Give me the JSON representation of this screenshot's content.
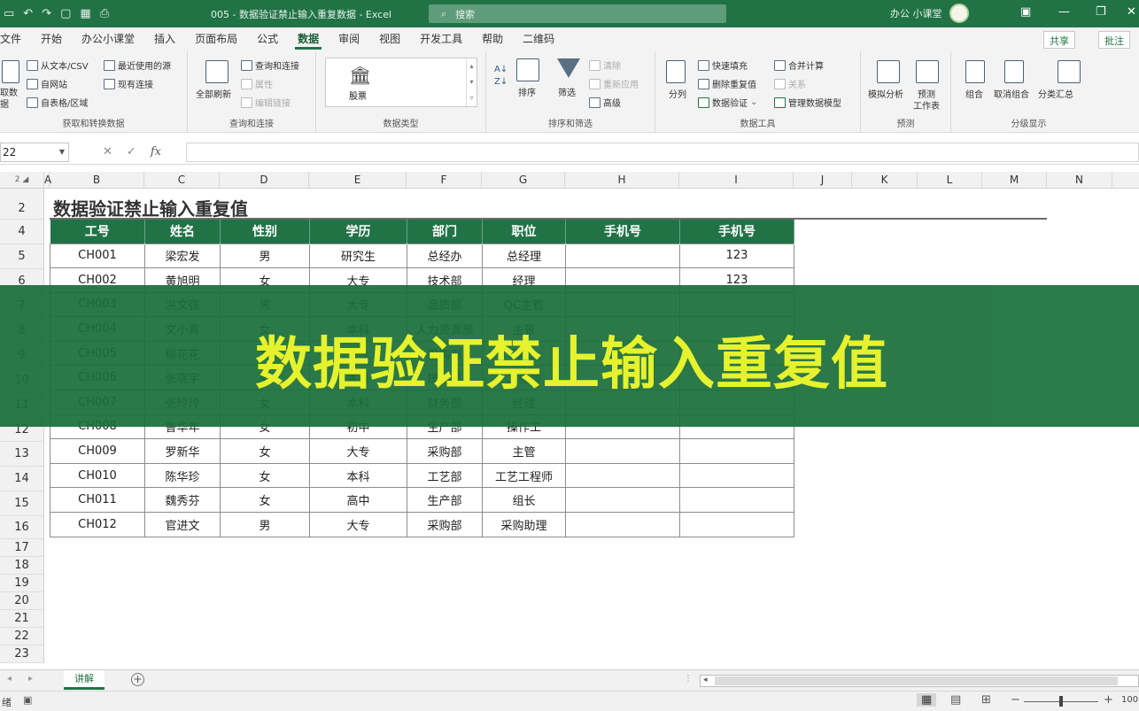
{
  "titlebar": {
    "qat_icons": [
      "save-icon",
      "undo-icon",
      "redo-icon",
      "form-icon",
      "table-icon",
      "print-icon"
    ],
    "doc_title": "005 - 数据验证禁止输入重复数据  -  Excel",
    "search_placeholder": "搜索",
    "user_name": "办公 小课堂",
    "bg_color": "#217346"
  },
  "tabs": [
    "文件",
    "开始",
    "办公小课堂",
    "插入",
    "页面布局",
    "公式",
    "数据",
    "审阅",
    "视图",
    "开发工具",
    "帮助",
    "二维码"
  ],
  "active_tab": "数据",
  "share_label": "共享",
  "comment_label": "批注",
  "ribbon": {
    "get_data": {
      "big_label_1": "取数",
      "big_label_2": "据",
      "items": [
        "从文本/CSV",
        "自网站",
        "自表格/区域",
        "最近使用的源",
        "现有连接"
      ],
      "label": "获取和转换数据"
    },
    "queries": {
      "refresh_label": "全部刷新",
      "items": [
        "查询和连接",
        "属性",
        "编辑链接"
      ],
      "label": "查询和连接"
    },
    "datatype": {
      "stock_label": "股票",
      "label": "数据类型"
    },
    "sort": {
      "sort_label": "排序",
      "filter_label": "筛选",
      "items": [
        "清除",
        "重新应用",
        "高级"
      ],
      "label": "排序和筛选"
    },
    "tools": {
      "split_label": "分列",
      "items": [
        "快速填充",
        "删除重复值",
        "数据验证",
        "合并计算",
        "关系",
        "管理数据模型"
      ],
      "label": "数据工具"
    },
    "forecast": {
      "whatif_label": "模拟分析",
      "sheet_label_1": "预测",
      "sheet_label_2": "工作表",
      "label": "预测"
    },
    "outline": {
      "items": [
        "组合",
        "取消组合",
        "分类汇总"
      ],
      "label": "分级显示"
    }
  },
  "formula_bar": {
    "name_box": "22",
    "fx": "fx"
  },
  "columns": [
    "A",
    "B",
    "C",
    "D",
    "E",
    "F",
    "G",
    "H",
    "I",
    "J",
    "K",
    "L",
    "M",
    "N"
  ],
  "rows": [
    "2",
    "4",
    "5",
    "6",
    "7",
    "8",
    "9",
    "10",
    "11",
    "12",
    "13",
    "14",
    "15",
    "16",
    "17",
    "18",
    "19",
    "20",
    "21",
    "22",
    "23"
  ],
  "sheet": {
    "title": "数据验证禁止输入重复值",
    "headers": [
      "工号",
      "姓名",
      "性别",
      "学历",
      "部门",
      "职位",
      "手机号",
      "手机号"
    ],
    "data": [
      [
        "CH001",
        "梁宏发",
        "男",
        "研究生",
        "总经办",
        "总经理",
        "",
        "123"
      ],
      [
        "CH002",
        "黄旭明",
        "女",
        "大专",
        "技术部",
        "经理",
        "",
        "123"
      ],
      [
        "CH003",
        "洪文强",
        "男",
        "大专",
        "品质部",
        "QC主管",
        "",
        ""
      ],
      [
        "CH004",
        "文小青",
        "女",
        "本科",
        "人力资源部",
        "主管",
        "",
        ""
      ],
      [
        "CH005",
        "柳花花",
        "女",
        "大专",
        "采购部",
        "专员",
        "",
        ""
      ],
      [
        "CH006",
        "张晓宇",
        "男",
        "本科",
        "技术部",
        "工程师",
        "",
        ""
      ],
      [
        "CH007",
        "张玲玲",
        "女",
        "本科",
        "财务部",
        "经理",
        "",
        ""
      ],
      [
        "CH008",
        "鲁华年",
        "女",
        "初中",
        "生产部",
        "操作工",
        "",
        ""
      ],
      [
        "CH009",
        "罗新华",
        "女",
        "大专",
        "采购部",
        "主管",
        "",
        ""
      ],
      [
        "CH010",
        "陈华珍",
        "女",
        "本科",
        "工艺部",
        "工艺工程师",
        "",
        ""
      ],
      [
        "CH011",
        "魏秀芬",
        "女",
        "高中",
        "生产部",
        "组长",
        "",
        ""
      ],
      [
        "CH012",
        "官进文",
        "男",
        "大专",
        "采购部",
        "采购助理",
        "",
        ""
      ]
    ]
  },
  "banner": {
    "text": "数据验证禁止输入重复值",
    "text_color": "#e6f22d",
    "bg_color": "#1b6e3a"
  },
  "sheet_tabs": [
    "讲解"
  ],
  "status": {
    "ready": "绪",
    "zoom": "100"
  }
}
